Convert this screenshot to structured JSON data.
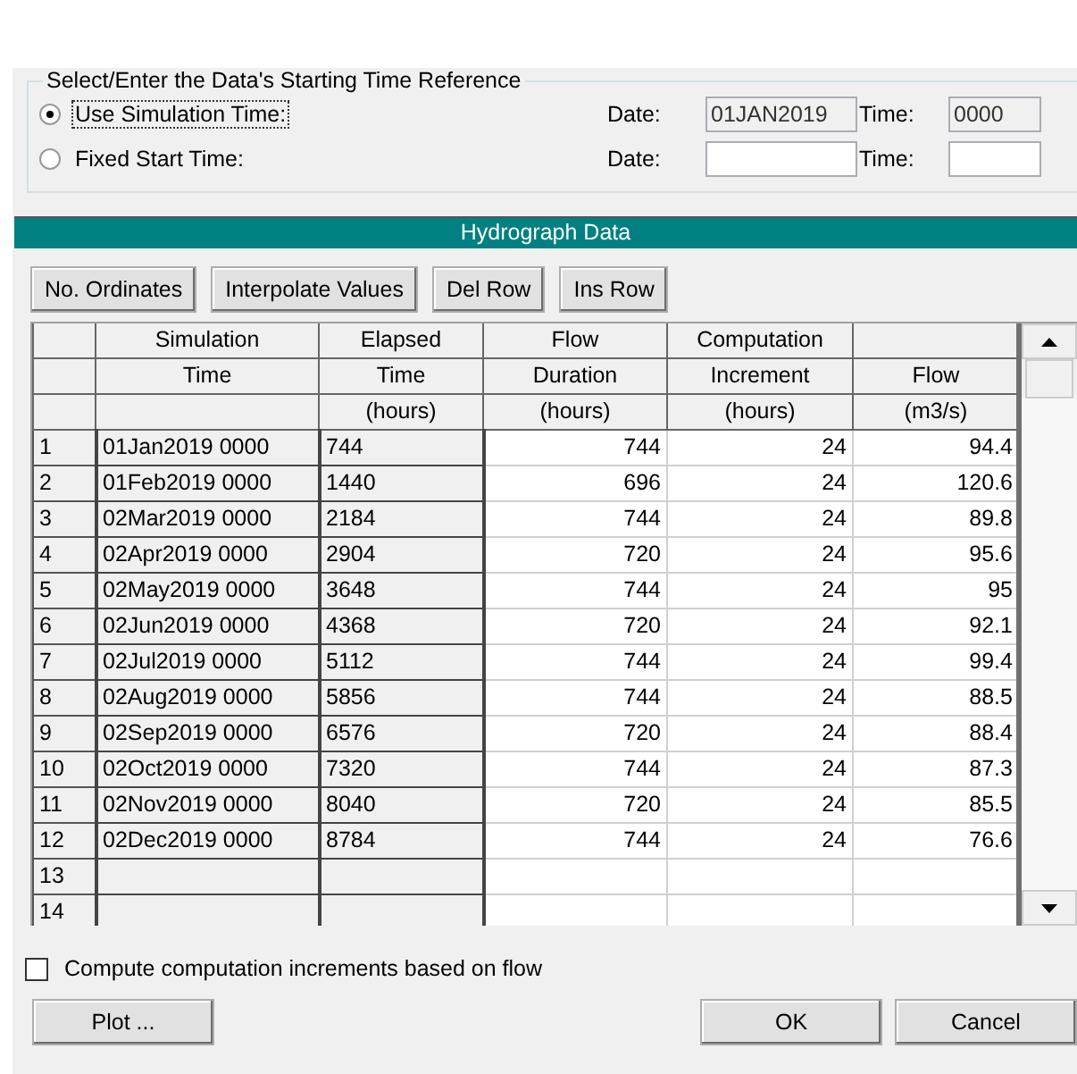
{
  "time_reference": {
    "title": "Select/Enter the Data's Starting Time Reference",
    "options": [
      {
        "label": "Use Simulation Time:",
        "selected": true,
        "focused": true,
        "date_label": "Date:",
        "date": "01JAN2019",
        "time_label": "Time:",
        "time": "0000",
        "fields_disabled": true
      },
      {
        "label": "Fixed Start Time:",
        "selected": false,
        "focused": false,
        "date_label": "Date:",
        "time_label": "Time:",
        "fields_disabled": false
      }
    ]
  },
  "section_title": "Hydrograph Data",
  "toolbar": [
    "No. Ordinates",
    "Interpolate Values",
    "Del Row",
    "Ins Row"
  ],
  "table": {
    "columns": [
      {
        "line_1": "Simulation",
        "line_2": "Time",
        "editable": false
      },
      {
        "line_1": "Elapsed",
        "line_2": "Time",
        "line_3": "(hours)",
        "editable": false
      },
      {
        "line_1": "Flow",
        "line_2": "Duration",
        "line_3": "(hours)",
        "editable": true
      },
      {
        "line_1": "Computation",
        "line_2": "Increment",
        "line_3": "(hours)",
        "editable": true
      },
      {
        "line_2": "Flow",
        "line_3": "(m3/s)",
        "editable": true
      }
    ],
    "rows": [
      {
        "number": "1",
        "cells": [
          "01Jan2019 0000",
          "744",
          "744",
          "24",
          "94.4"
        ]
      },
      {
        "number": "2",
        "cells": [
          "01Feb2019 0000",
          "1440",
          "696",
          "24",
          "120.6"
        ]
      },
      {
        "number": "3",
        "cells": [
          "02Mar2019 0000",
          "2184",
          "744",
          "24",
          "89.8"
        ]
      },
      {
        "number": "4",
        "cells": [
          "02Apr2019 0000",
          "2904",
          "720",
          "24",
          "95.6"
        ]
      },
      {
        "number": "5",
        "cells": [
          "02May2019 0000",
          "3648",
          "744",
          "24",
          "95"
        ]
      },
      {
        "number": "6",
        "cells": [
          "02Jun2019 0000",
          "4368",
          "720",
          "24",
          "92.1"
        ]
      },
      {
        "number": "7",
        "cells": [
          "02Jul2019 0000",
          "5112",
          "744",
          "24",
          "99.4"
        ]
      },
      {
        "number": "8",
        "cells": [
          "02Aug2019 0000",
          "5856",
          "744",
          "24",
          "88.5"
        ]
      },
      {
        "number": "9",
        "cells": [
          "02Sep2019 0000",
          "6576",
          "720",
          "24",
          "88.4"
        ]
      },
      {
        "number": "10",
        "cells": [
          "02Oct2019 0000",
          "7320",
          "744",
          "24",
          "87.3"
        ]
      },
      {
        "number": "11",
        "cells": [
          "02Nov2019 0000",
          "8040",
          "720",
          "24",
          "85.5"
        ]
      },
      {
        "number": "12",
        "cells": [
          "02Dec2019 0000",
          "8784",
          "744",
          "24",
          "76.6"
        ]
      },
      {
        "number": "13",
        "cells": []
      },
      {
        "number": "14",
        "cells": []
      }
    ]
  },
  "compute_option": {
    "label": "Compute computation increments based on flow",
    "checked": false
  },
  "buttons": {
    "left": [
      "Plot ..."
    ],
    "right": [
      "OK",
      "Cancel"
    ]
  }
}
